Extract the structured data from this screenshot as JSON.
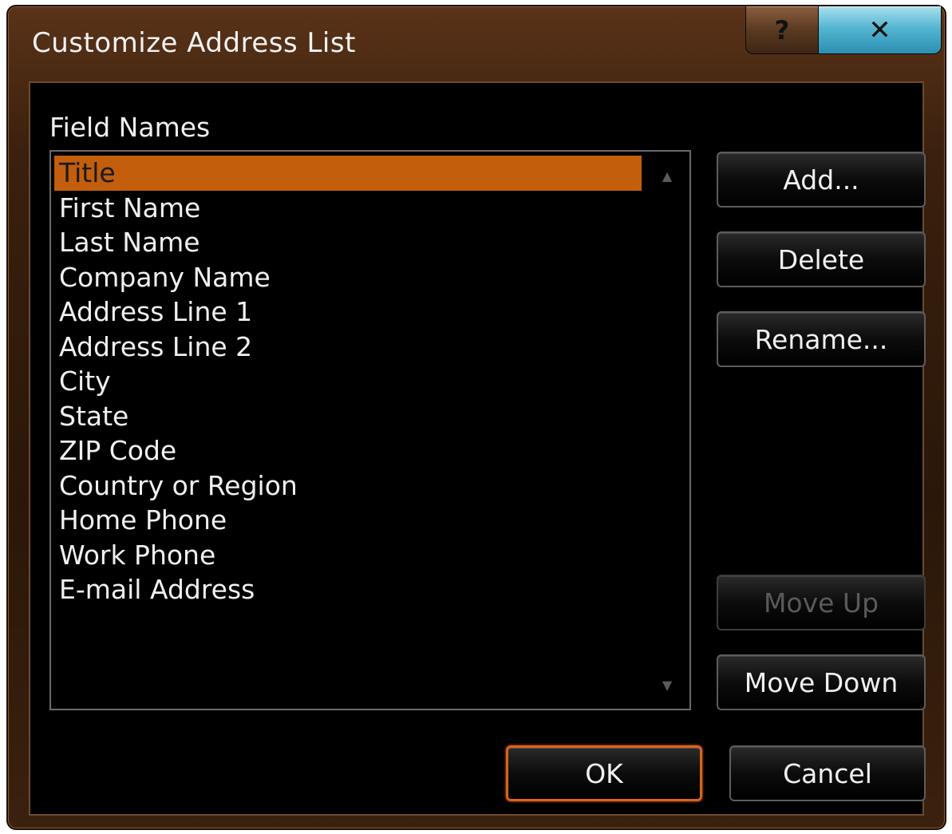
{
  "dialog": {
    "title": "Customize Address List",
    "help_glyph": "?",
    "close_glyph": "✕"
  },
  "field_names": {
    "label": "Field Names",
    "items": [
      "Title",
      "First Name",
      "Last Name",
      "Company Name",
      "Address Line 1",
      "Address Line 2",
      "City",
      "State",
      "ZIP Code",
      "Country or Region",
      "Home Phone",
      "Work Phone",
      "E-mail Address"
    ],
    "selected": "Title",
    "scroll_up_glyph": "▲",
    "scroll_down_glyph": "▼"
  },
  "buttons": {
    "add": "Add...",
    "delete": "Delete",
    "rename": "Rename...",
    "move_up": "Move Up",
    "move_down": "Move Down",
    "ok": "OK",
    "cancel": "Cancel"
  },
  "colors": {
    "selection": "#c25e0c",
    "default_button_border": "#d9631a",
    "frame": "#3a200e"
  }
}
